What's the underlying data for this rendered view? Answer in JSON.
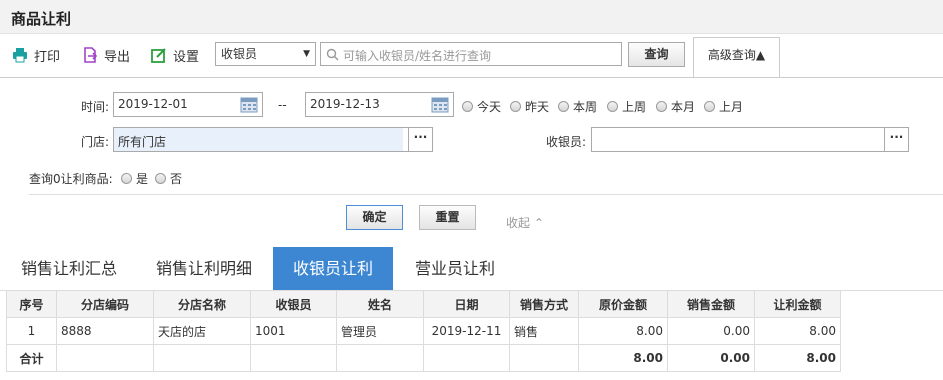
{
  "title": "商品让利",
  "toolbar": {
    "print": "打印",
    "export": "导出",
    "settings": "设置"
  },
  "query_select": {
    "value": "收银员"
  },
  "search": {
    "placeholder": "可输入收银员/姓名进行查询",
    "button": "查询"
  },
  "advanced": {
    "label": "高级查询▲"
  },
  "filters": {
    "time_label": "时间:",
    "date_from": "2019-12-01",
    "date_sep": "--",
    "date_to": "2019-12-13",
    "ranges": [
      "今天",
      "昨天",
      "本周",
      "上周",
      "本月",
      "上月"
    ],
    "store_label": "门店:",
    "store_value": "所有门店",
    "cashier_label": "收银员:",
    "cashier_value": "",
    "more": "···",
    "zero_label": "查询0让利商品:",
    "yes": "是",
    "no": "否"
  },
  "actions": {
    "confirm": "确定",
    "reset": "重置",
    "collapse": "收起 ⌃"
  },
  "tabs": [
    {
      "label": "销售让利汇总",
      "active": false
    },
    {
      "label": "销售让利明细",
      "active": false
    },
    {
      "label": "收银员让利",
      "active": true
    },
    {
      "label": "营业员让利",
      "active": false
    }
  ],
  "table": {
    "headers": [
      "序号",
      "分店编码",
      "分店名称",
      "收银员",
      "姓名",
      "日期",
      "销售方式",
      "原价金额",
      "销售金额",
      "让利金额"
    ],
    "rows": [
      [
        "1",
        "8888",
        "天店的店",
        "1001",
        "管理员",
        "2019-12-11",
        "销售",
        "8.00",
        "0.00",
        "8.00"
      ]
    ],
    "total": [
      "合计",
      "",
      "",
      "",
      "",
      "",
      "",
      "8.00",
      "0.00",
      "8.00"
    ]
  },
  "colors": {
    "accent": "#3d87d2",
    "icon_teal": "#1aa0a0",
    "icon_purple": "#a044c8",
    "icon_green": "#2e9e3e"
  }
}
